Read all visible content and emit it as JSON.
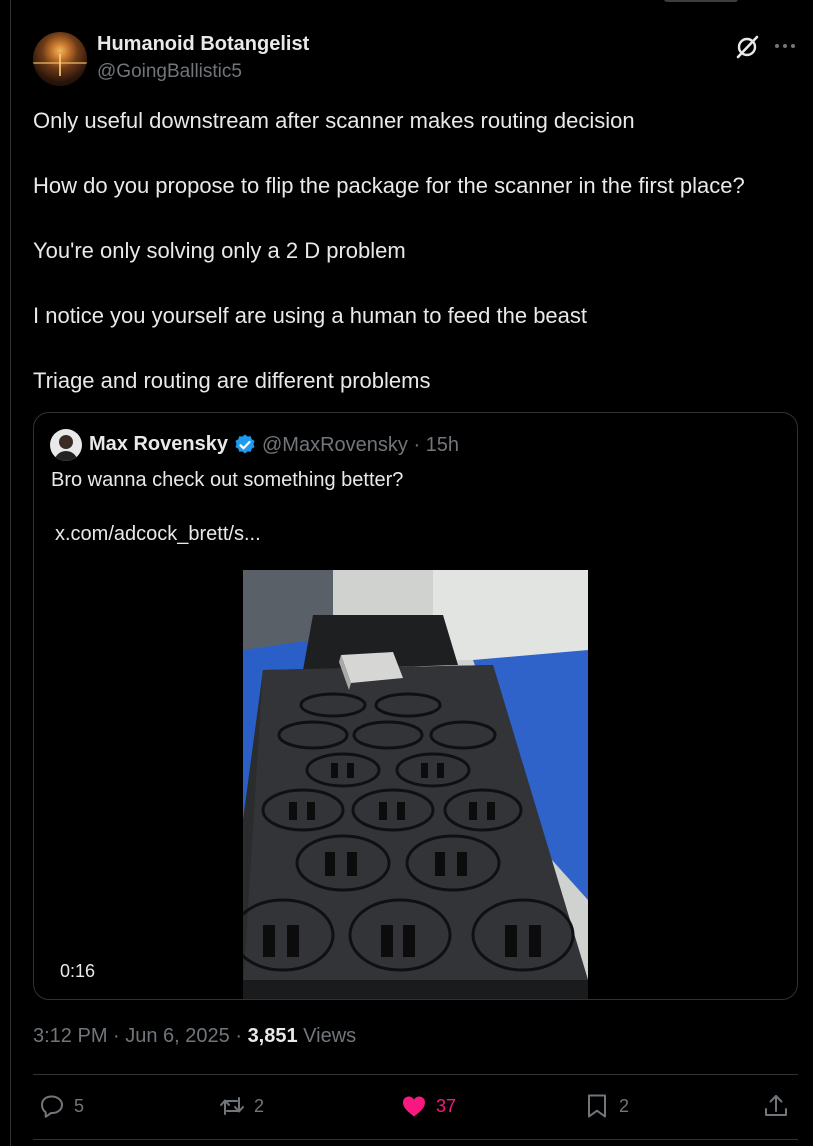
{
  "author": {
    "display_name": "Humanoid Botangelist",
    "handle": "@GoingBallistic5"
  },
  "icons": {
    "grok": "grok-icon",
    "more": "more-icon",
    "reply": "reply-icon",
    "repost": "repost-icon",
    "like": "heart-icon",
    "bookmark": "bookmark-icon",
    "share": "share-icon",
    "verified": "verified-badge-icon"
  },
  "post": {
    "paragraphs": [
      "Only useful downstream after scanner makes routing decision",
      "How do you propose to flip the package for the scanner in the first place?",
      "You're only solving only a 2 D problem",
      "I notice you yourself are using a human to feed the beast",
      "Triage and routing are different problems"
    ]
  },
  "quoted": {
    "display_name": "Max Rovensky",
    "handle_time": "@MaxRovensky · 15h",
    "text": "Bro wanna check out something better?",
    "link": "x.com/adcock_brett/s...",
    "video_duration": "0:16"
  },
  "meta": {
    "time_date": "3:12 PM · Jun 6, 2025 · ",
    "views_count": "3,851",
    "views_label": " Views"
  },
  "actions": {
    "replies": "5",
    "reposts": "2",
    "likes": "37",
    "bookmarks": "2"
  },
  "colors": {
    "background": "#000000",
    "text": "#e7e9ea",
    "muted": "#71767b",
    "border": "#2f3336",
    "like": "#f91880",
    "verified": "#1d9bf0"
  }
}
